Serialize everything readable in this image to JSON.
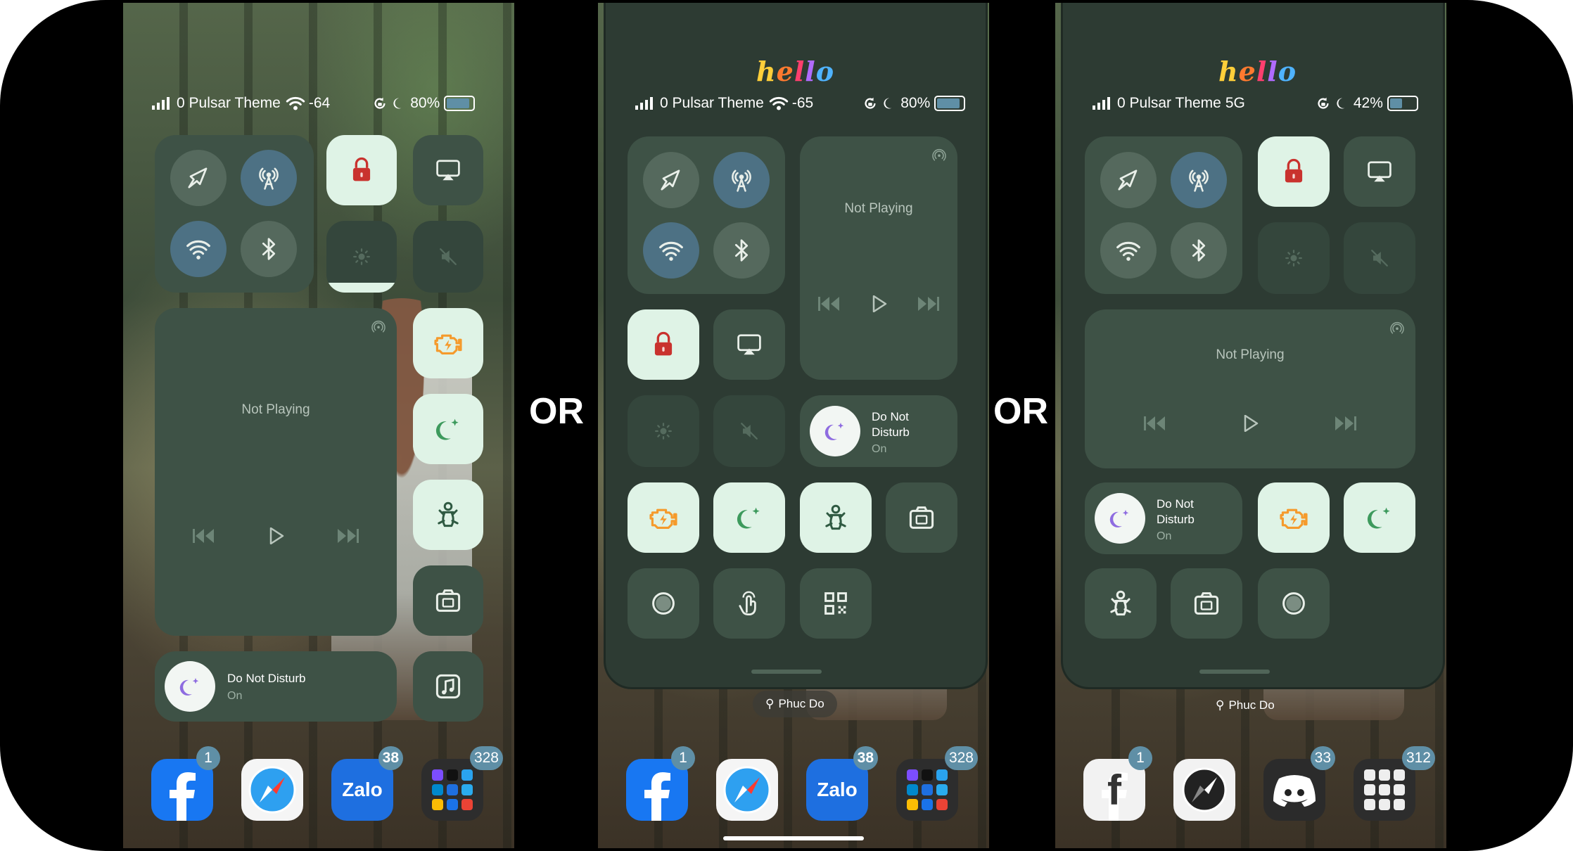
{
  "separators": {
    "left": "OR",
    "right": "OR"
  },
  "colors": {
    "tile": "#3e5246",
    "tile_light": "#dff3e6",
    "accent_blue": "#4d7184",
    "accent_orange": "#f59a2c",
    "accent_green": "#3d9a5d",
    "lock_red": "#c9322e",
    "badge": "#5f8fa6"
  },
  "panel1": {
    "status": {
      "carrier": "0 Pulsar Theme",
      "signal": "-64",
      "battery": "80%"
    },
    "media": {
      "now_playing": "Not Playing"
    },
    "dnd": {
      "title": "Do Not Disturb",
      "state": "On"
    },
    "dock": [
      {
        "icon": "facebook-icon",
        "badge": "1"
      },
      {
        "icon": "safari-icon",
        "badge": ""
      },
      {
        "icon": "zalo-icon",
        "label": "Zalo",
        "badge": "38"
      },
      {
        "icon": "app-folder-icon",
        "badge": "328"
      }
    ]
  },
  "panel2": {
    "hello": "hello",
    "status": {
      "carrier": "0 Pulsar Theme",
      "signal": "-65",
      "battery": "80%"
    },
    "media": {
      "now_playing": "Not Playing"
    },
    "dnd": {
      "title": "Do Not Disturb",
      "state": "On"
    },
    "search": "Phuc Do",
    "dock": [
      {
        "icon": "facebook-icon",
        "badge": "1"
      },
      {
        "icon": "safari-icon",
        "badge": ""
      },
      {
        "icon": "zalo-icon",
        "label": "Zalo",
        "badge": "38"
      },
      {
        "icon": "app-folder-icon",
        "badge": "328"
      }
    ]
  },
  "panel3": {
    "hello": "hello",
    "status": {
      "carrier": "0 Pulsar Theme",
      "network": "5G",
      "battery": "42%"
    },
    "media": {
      "now_playing": "Not Playing"
    },
    "dnd": {
      "title": "Do Not Disturb",
      "state": "On"
    },
    "search": "Phuc Do",
    "dock": [
      {
        "icon": "facebook-icon",
        "badge": "1"
      },
      {
        "icon": "compass-icon",
        "badge": ""
      },
      {
        "icon": "discord-icon",
        "badge": "33"
      },
      {
        "icon": "app-folder-icon",
        "badge": "312"
      }
    ]
  }
}
